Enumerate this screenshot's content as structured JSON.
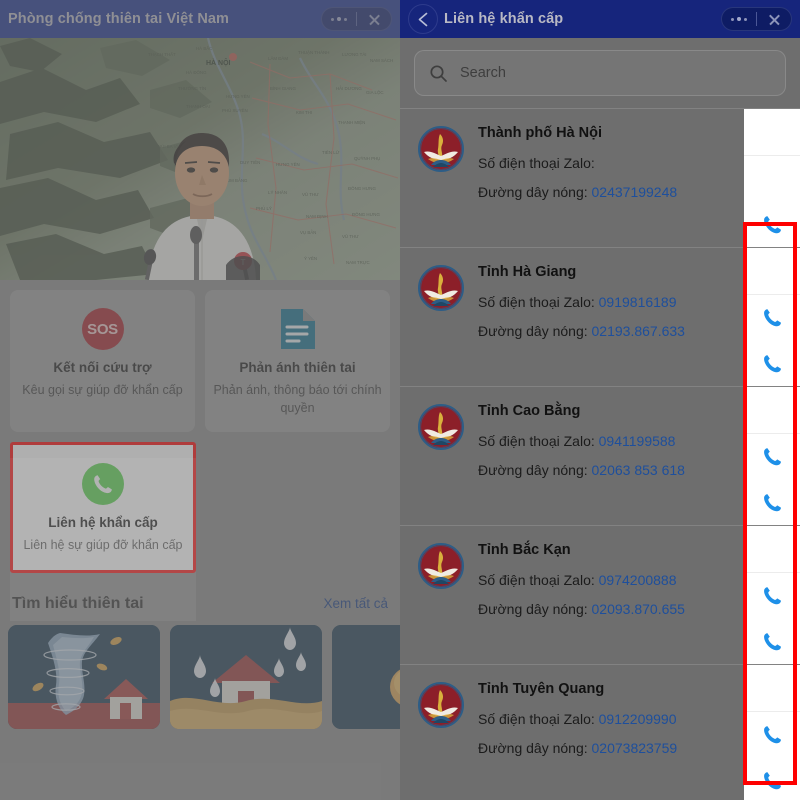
{
  "left_window": {
    "title": "Phòng chống thiên tai Việt Nam",
    "more_icon": "more-horizontal-icon",
    "close_icon": "close-icon",
    "hero": {
      "alt": "news-video-thumbnail-official-at-podium-with-topographic-map"
    },
    "feature_cards": [
      {
        "icon": "sos-icon",
        "icon_label": "SOS",
        "title": "Kết nối cứu trợ",
        "subtitle": "Kêu gọi sự giúp đỡ khẩn cấp",
        "accent": "#a4232a"
      },
      {
        "icon": "document-report-icon",
        "icon_label": "",
        "title": "Phản ánh thiên tai",
        "subtitle": "Phản ánh, thông báo tới chính quyền",
        "accent": "#16708f"
      },
      {
        "icon": "phone-call-icon",
        "icon_label": "",
        "title": "Liên hệ khẩn cấp",
        "subtitle": "Liên hệ sự giúp đỡ khẩn cấp",
        "accent": "#49d13e",
        "highlighted": true,
        "highlight_color": "#fe0000"
      }
    ],
    "learn_section": {
      "title": "Tìm hiểu thiên tai",
      "see_all_label": "Xem tất cả",
      "see_all_color": "#1b3f86",
      "thumbnails": [
        {
          "name": "tornado-illustration"
        },
        {
          "name": "flood-rain-house-illustration"
        },
        {
          "name": "third-card-partial"
        }
      ]
    }
  },
  "right_window": {
    "title": "Liên hệ khẩn cấp",
    "back_icon": "arrow-left-icon",
    "more_icon": "more-horizontal-icon",
    "close_icon": "close-icon",
    "search": {
      "icon": "search-icon",
      "placeholder": "Search",
      "value": ""
    },
    "labels": {
      "zalo": "Số điện thoại Zalo:",
      "hotline": "Đường dây nóng:",
      "call_icon": "phone-call-icon",
      "number_color": "#1e4f9c"
    },
    "contacts": [
      {
        "emblem": "vietnam-disaster-authority-emblem",
        "name": "Thành phố Hà Nội",
        "zalo": "",
        "hotline": "02437199248",
        "call_buttons": 1
      },
      {
        "emblem": "vietnam-disaster-authority-emblem",
        "name": "Tỉnh Hà Giang",
        "zalo": "0919816189",
        "hotline": "02193.867.633",
        "call_buttons": 2
      },
      {
        "emblem": "vietnam-disaster-authority-emblem",
        "name": "Tỉnh Cao Bằng",
        "zalo": "0941199588",
        "hotline": "02063 853 618",
        "call_buttons": 2
      },
      {
        "emblem": "vietnam-disaster-authority-emblem",
        "name": "Tỉnh Bắc Kạn",
        "zalo": "0974200888",
        "hotline": "02093.870.655",
        "call_buttons": 2
      },
      {
        "emblem": "vietnam-disaster-authority-emblem",
        "name": "Tỉnh Tuyên Quang",
        "zalo": "0912209990",
        "hotline": "02073823759",
        "call_buttons": 2
      }
    ]
  },
  "annotation": {
    "box_color": "#fe0000",
    "target": "call-button-column"
  }
}
